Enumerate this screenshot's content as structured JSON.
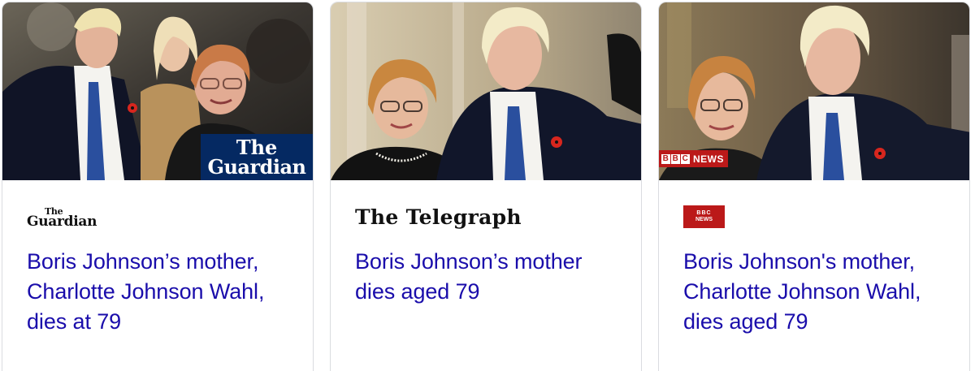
{
  "cards": [
    {
      "source": "The Guardian",
      "logo_small": "The",
      "logo_big": "Guardian",
      "badge_small": "The",
      "badge_big": "Guardian",
      "headline": "Boris Johnson’s mother, Charlotte Johnson Wahl, dies at 79"
    },
    {
      "source": "The Telegraph",
      "logo_text": "The Telegraph",
      "headline": "Boris Johnson’s mother dies aged 79"
    },
    {
      "source": "BBC News",
      "logo_line1": "BBC",
      "logo_line2": "NEWS",
      "badge_letters": [
        "B",
        "B",
        "C"
      ],
      "badge_text": "NEWS",
      "headline": "Boris Johnson's mother, Charlotte Johnson Wahl, dies aged 79"
    }
  ],
  "colors": {
    "headline": "#1a0dab",
    "guardian_navy": "#052962",
    "bbc_red": "#bb1919",
    "poppy_red": "#d7261e",
    "tie_blue": "#2a4f9e"
  },
  "icons": {
    "poppy": "poppy-icon"
  }
}
